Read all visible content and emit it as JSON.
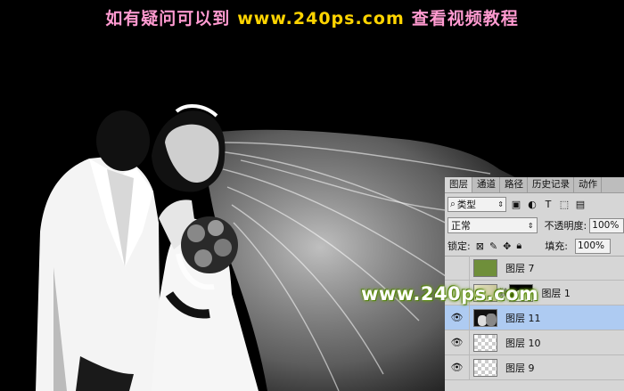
{
  "banner": {
    "left_text": "如有疑问可以到",
    "url": "www.240ps.com",
    "right_text": "查看视频教程"
  },
  "watermark": "www.240ps.com",
  "colors": {
    "banner_pink": "#ff9ad0",
    "banner_yellow": "#ffd400",
    "watermark_glow": "#6b9a1a",
    "panel_bg": "#d6d6d6",
    "selected_layer": "#aecbf2"
  },
  "panel": {
    "tabs": [
      "图层",
      "通道",
      "路径",
      "历史记录",
      "动作"
    ],
    "active_tab": "图层",
    "filter_kind": "类型",
    "filter_icons": [
      "image-filter-icon",
      "adjustment-filter-icon",
      "text-filter-icon",
      "shape-filter-icon",
      "smart-object-filter-icon"
    ],
    "blend_mode": "正常",
    "opacity_label": "不透明度:",
    "opacity_value": "100%",
    "lock_label": "锁定:",
    "fill_label": "填充:",
    "fill_value": "100%",
    "layers": [
      {
        "name": "图层 7",
        "visible": false,
        "thumb": "green",
        "selected": false
      },
      {
        "name": "图层 1",
        "visible": false,
        "thumb": "photo+mask",
        "selected": false
      },
      {
        "name": "图层 11",
        "visible": true,
        "thumb": "photo",
        "selected": true
      },
      {
        "name": "图层 10",
        "visible": true,
        "thumb": "transparent",
        "selected": false
      },
      {
        "name": "图层 9",
        "visible": true,
        "thumb": "transparent",
        "selected": false
      }
    ]
  }
}
